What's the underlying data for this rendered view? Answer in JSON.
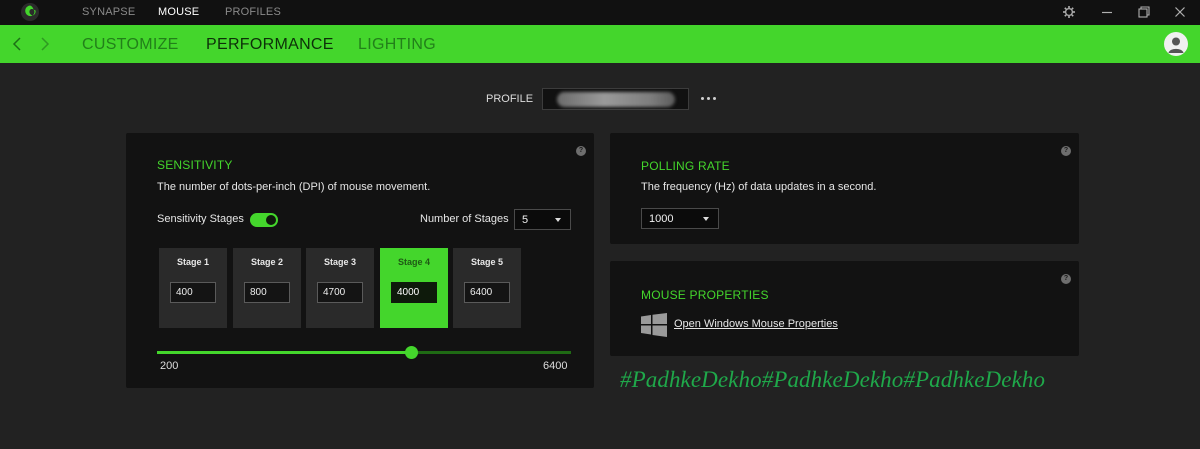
{
  "topbar": {
    "tabs": [
      {
        "label": "SYNAPSE",
        "active": false
      },
      {
        "label": "MOUSE",
        "active": true
      },
      {
        "label": "PROFILES",
        "active": false
      }
    ],
    "icons": [
      "razer-logo-icon",
      "gear-icon",
      "minimize-icon",
      "restore-icon",
      "close-icon"
    ]
  },
  "subnav": {
    "tabs": [
      {
        "label": "CUSTOMIZE",
        "active": false
      },
      {
        "label": "PERFORMANCE",
        "active": true
      },
      {
        "label": "LIGHTING",
        "active": false
      }
    ],
    "icons": [
      "back-arrow-icon",
      "forward-arrow-icon",
      "user-avatar-icon"
    ]
  },
  "profile": {
    "label": "PROFILE",
    "value": ""
  },
  "sensitivity": {
    "title": "SENSITIVITY",
    "description": "The number of dots-per-inch (DPI) of mouse movement.",
    "stages_label": "Sensitivity Stages",
    "stages_enabled": true,
    "num_stages_label": "Number of Stages",
    "num_stages_value": "5",
    "stages": [
      {
        "name": "Stage 1",
        "value": "400",
        "active": false
      },
      {
        "name": "Stage 2",
        "value": "800",
        "active": false
      },
      {
        "name": "Stage 3",
        "value": "4700",
        "active": false
      },
      {
        "name": "Stage 4",
        "value": "4000",
        "active": true
      },
      {
        "name": "Stage 5",
        "value": "6400",
        "active": false
      }
    ],
    "slider": {
      "min": "200",
      "max": "6400",
      "value": 4000
    }
  },
  "polling": {
    "title": "POLLING RATE",
    "description": "The frequency (Hz) of data updates in a second.",
    "value": "1000"
  },
  "mouse_properties": {
    "title": "MOUSE PROPERTIES",
    "link": "Open Windows Mouse Properties",
    "icon": "windows-logo-icon"
  },
  "watermark": "#PadhkeDekho#PadhkeDekho#PadhkeDekho",
  "colors": {
    "accent": "#44d62c",
    "background": "#222222",
    "panel": "#121212",
    "watermark": "#1fa84a"
  }
}
